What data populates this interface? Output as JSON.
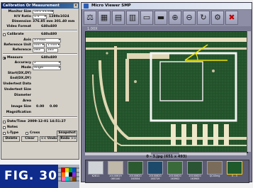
{
  "calibration": {
    "title": "Calibration Or Measurement",
    "monitor_size": {
      "label": "Monitor Size",
      "value": "19.0 Inches"
    },
    "hv_ratio": {
      "label": "H/V Ratio",
      "value": "1.4",
      "resolution": "1280x1024"
    },
    "dimension": {
      "label": "Dimension",
      "value": "376.85 mm  301.40 mm"
    },
    "video_format": {
      "label": "Video Format",
      "value": "640x480"
    },
    "calibrate": {
      "label": "Calibrate",
      "value": "640x480",
      "checked": false
    },
    "axis": {
      "label": "Axis",
      "value": "XY-Axis"
    },
    "reference_unit": {
      "label": "Reference Unit",
      "value": "mm",
      "unit": "1 mm"
    },
    "reference": {
      "label": "Reference",
      "value1": "283",
      "value2": "283"
    },
    "measure": {
      "label": "Measure",
      "value": "640x480",
      "checked": true
    },
    "accuracy": {
      "label": "Accuracy",
      "value": "2"
    },
    "mode": {
      "label": "Mode",
      "value": "Angle"
    },
    "start": {
      "label": "Start(DX,DY)"
    },
    "end": {
      "label": "End(DX,DY)"
    },
    "undertest_data": {
      "label": "Undertest Data"
    },
    "undertest_size": {
      "label": "Undertest Size"
    },
    "diameter": {
      "label": "Diameter"
    },
    "area": {
      "label": "Area"
    },
    "image_size": {
      "label": "Image Size",
      "w": "0.00",
      "h": "0.00"
    },
    "magnification": {
      "label": "Magnification"
    },
    "datetime": {
      "label": "Date/Time",
      "value": "2009-12-01  14:51:27",
      "checked": false
    },
    "notes": {
      "label": "Notes",
      "checked": false
    },
    "ltype": {
      "label": "L-Type",
      "checked": false
    },
    "cross": {
      "label": "Cross",
      "checked": false
    },
    "snapshot": {
      "label": "Snapshot"
    },
    "buttons": {
      "delete": "Delete",
      "clear": "Clear",
      "undo": "<< Undo",
      "redo": "Redo >>"
    }
  },
  "figure": {
    "label": "FIG. 30"
  },
  "viewer": {
    "title": "Micro Viewer SMP",
    "zoom_label": "1.00X",
    "toolbar_icons": [
      "measure-icon",
      "open-folder-icon",
      "save-icon",
      "delete-icon",
      "print-icon",
      "scanner-icon",
      "zoom-in-icon",
      "zoom-out-icon",
      "rotate-icon",
      "settings-icon",
      "exit-icon"
    ],
    "caption": "0 - 3.jpg (651 x 493)",
    "thumbnails": [
      {
        "label": "K2811"
      },
      {
        "label": "20100619 085140"
      },
      {
        "label": "20100620 163554"
      },
      {
        "label": "20100620 163719"
      },
      {
        "label": "20100620 163902"
      },
      {
        "label": "20100620 163905"
      },
      {
        "label": "QC40mg"
      },
      {
        "label": "0 - 3"
      }
    ],
    "selected_thumbnail": 7,
    "colors": {
      "trace": "#f0e8c8",
      "board": "#1f5a2a",
      "measure": "#f2e200",
      "accent": "#0f2c8c"
    }
  }
}
